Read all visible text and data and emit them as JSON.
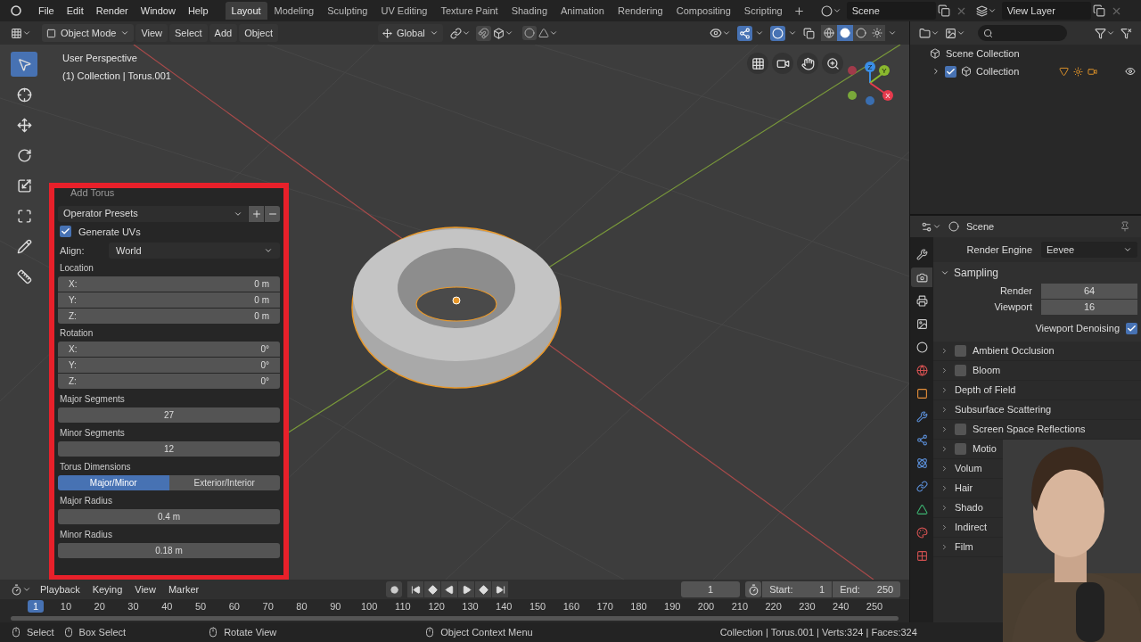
{
  "menu_bar": {
    "menus": [
      "File",
      "Edit",
      "Render",
      "Window",
      "Help"
    ],
    "workspaces": [
      {
        "label": "Layout",
        "selected": true
      },
      {
        "label": "Modeling",
        "selected": false
      },
      {
        "label": "Sculpting",
        "selected": false
      },
      {
        "label": "UV Editing",
        "selected": false
      },
      {
        "label": "Texture Paint",
        "selected": false
      },
      {
        "label": "Shading",
        "selected": false
      },
      {
        "label": "Animation",
        "selected": false
      },
      {
        "label": "Rendering",
        "selected": false
      },
      {
        "label": "Compositing",
        "selected": false
      },
      {
        "label": "Scripting",
        "selected": false
      }
    ],
    "scene": "Scene",
    "view_layer": "View Layer"
  },
  "viewport_header": {
    "mode": "Object Mode",
    "menus": [
      "View",
      "Select",
      "Add",
      "Object"
    ],
    "orientation": "Global"
  },
  "viewport": {
    "perspective": "User Perspective",
    "object_info": "(1) Collection | Torus.001",
    "tools": [
      {
        "kind": "select",
        "selected": true
      },
      {
        "kind": "cursor",
        "selected": false
      },
      {
        "kind": "move",
        "selected": false
      },
      {
        "kind": "rotate",
        "selected": false
      },
      {
        "kind": "scale",
        "selected": false
      },
      {
        "kind": "transform",
        "selected": false
      },
      {
        "kind": "annotate",
        "selected": false
      },
      {
        "kind": "measure",
        "selected": false
      }
    ],
    "gizmo": {
      "x": "X",
      "y": "Y",
      "z": "Z"
    }
  },
  "operator_panel": {
    "title": "Add Torus",
    "presets": "Operator Presets",
    "generate_uvs": {
      "label": "Generate UVs",
      "checked": true
    },
    "align": {
      "label": "Align:",
      "value": "World"
    },
    "location": {
      "label": "Location",
      "fields": [
        {
          "label": "X:",
          "value": "0 m"
        },
        {
          "label": "Y:",
          "value": "0 m"
        },
        {
          "label": "Z:",
          "value": "0 m"
        }
      ]
    },
    "rotation": {
      "label": "Rotation",
      "fields": [
        {
          "label": "X:",
          "value": "0°"
        },
        {
          "label": "Y:",
          "value": "0°"
        },
        {
          "label": "Z:",
          "value": "0°"
        }
      ]
    },
    "numbers": [
      {
        "label": "Major Segments",
        "value": "27"
      },
      {
        "label": "Minor Segments",
        "value": "12"
      }
    ],
    "dimensions": {
      "label": "Torus Dimensions",
      "options": [
        {
          "label": "Major/Minor",
          "selected": true
        },
        {
          "label": "Exterior/Interior",
          "selected": false
        }
      ]
    },
    "radii": [
      {
        "label": "Major Radius",
        "value": "0.4 m"
      },
      {
        "label": "Minor Radius",
        "value": "0.18 m"
      }
    ]
  },
  "timeline": {
    "menus": [
      "Playback",
      "Keying",
      "View",
      "Marker"
    ],
    "current_frame": "1",
    "start": {
      "label": "Start:",
      "value": "1"
    },
    "end": {
      "label": "End:",
      "value": "250"
    },
    "marker": "1",
    "ticks": [
      "10",
      "20",
      "30",
      "40",
      "50",
      "60",
      "70",
      "80",
      "90",
      "100",
      "110",
      "120",
      "130",
      "140",
      "150",
      "160",
      "170",
      "180",
      "190",
      "200",
      "210",
      "220",
      "230",
      "240",
      "250"
    ]
  },
  "outliner": {
    "items": [
      {
        "label": "Scene Collection",
        "children": [
          {
            "label": "Collection",
            "checked": true,
            "expanded": false
          }
        ]
      }
    ]
  },
  "properties": {
    "title": "Scene",
    "render_engine": {
      "label": "Render Engine",
      "value": "Eevee"
    },
    "tabs": [
      {
        "kind": "tool",
        "selected": false
      },
      {
        "kind": "render",
        "selected": true
      },
      {
        "kind": "output",
        "selected": false
      },
      {
        "kind": "view_layer",
        "selected": false
      },
      {
        "kind": "scene",
        "selected": false
      },
      {
        "kind": "world",
        "selected": false
      },
      {
        "kind": "object",
        "selected": false
      },
      {
        "kind": "modifiers",
        "selected": false
      },
      {
        "kind": "particles",
        "selected": false
      },
      {
        "kind": "physics",
        "selected": false
      },
      {
        "kind": "constraints",
        "selected": false
      },
      {
        "kind": "data",
        "selected": false
      },
      {
        "kind": "material",
        "selected": false
      },
      {
        "kind": "texture",
        "selected": false
      }
    ],
    "sampling": {
      "label": "Sampling",
      "expanded": true,
      "fields": [
        {
          "label": "Render",
          "value": "64"
        },
        {
          "label": "Viewport",
          "value": "16"
        }
      ],
      "denoising": {
        "label": "Viewport Denoising",
        "checked": true
      }
    },
    "sections": [
      {
        "label": "Ambient Occlusion",
        "kind": "toggle",
        "checked": false
      },
      {
        "label": "Bloom",
        "kind": "toggle",
        "checked": false
      },
      {
        "label": "Depth of Field",
        "kind": "plain"
      },
      {
        "label": "Subsurface Scattering",
        "kind": "plain"
      },
      {
        "label": "Screen Space Reflections",
        "kind": "toggle",
        "checked": false
      },
      {
        "label": "Motio",
        "kind": "toggle",
        "checked": false
      },
      {
        "label": "Volum",
        "kind": "plain"
      },
      {
        "label": "Hair",
        "kind": "plain"
      },
      {
        "label": "Shado",
        "kind": "plain"
      },
      {
        "label": "Indirect",
        "kind": "plain"
      },
      {
        "label": "Film",
        "kind": "plain"
      }
    ]
  },
  "status_bar": {
    "hints": [
      "Select",
      "Box Select",
      "Rotate View",
      "Object Context Menu"
    ],
    "stats": "Collection | Torus.001 | Verts:324 | Faces:324"
  }
}
